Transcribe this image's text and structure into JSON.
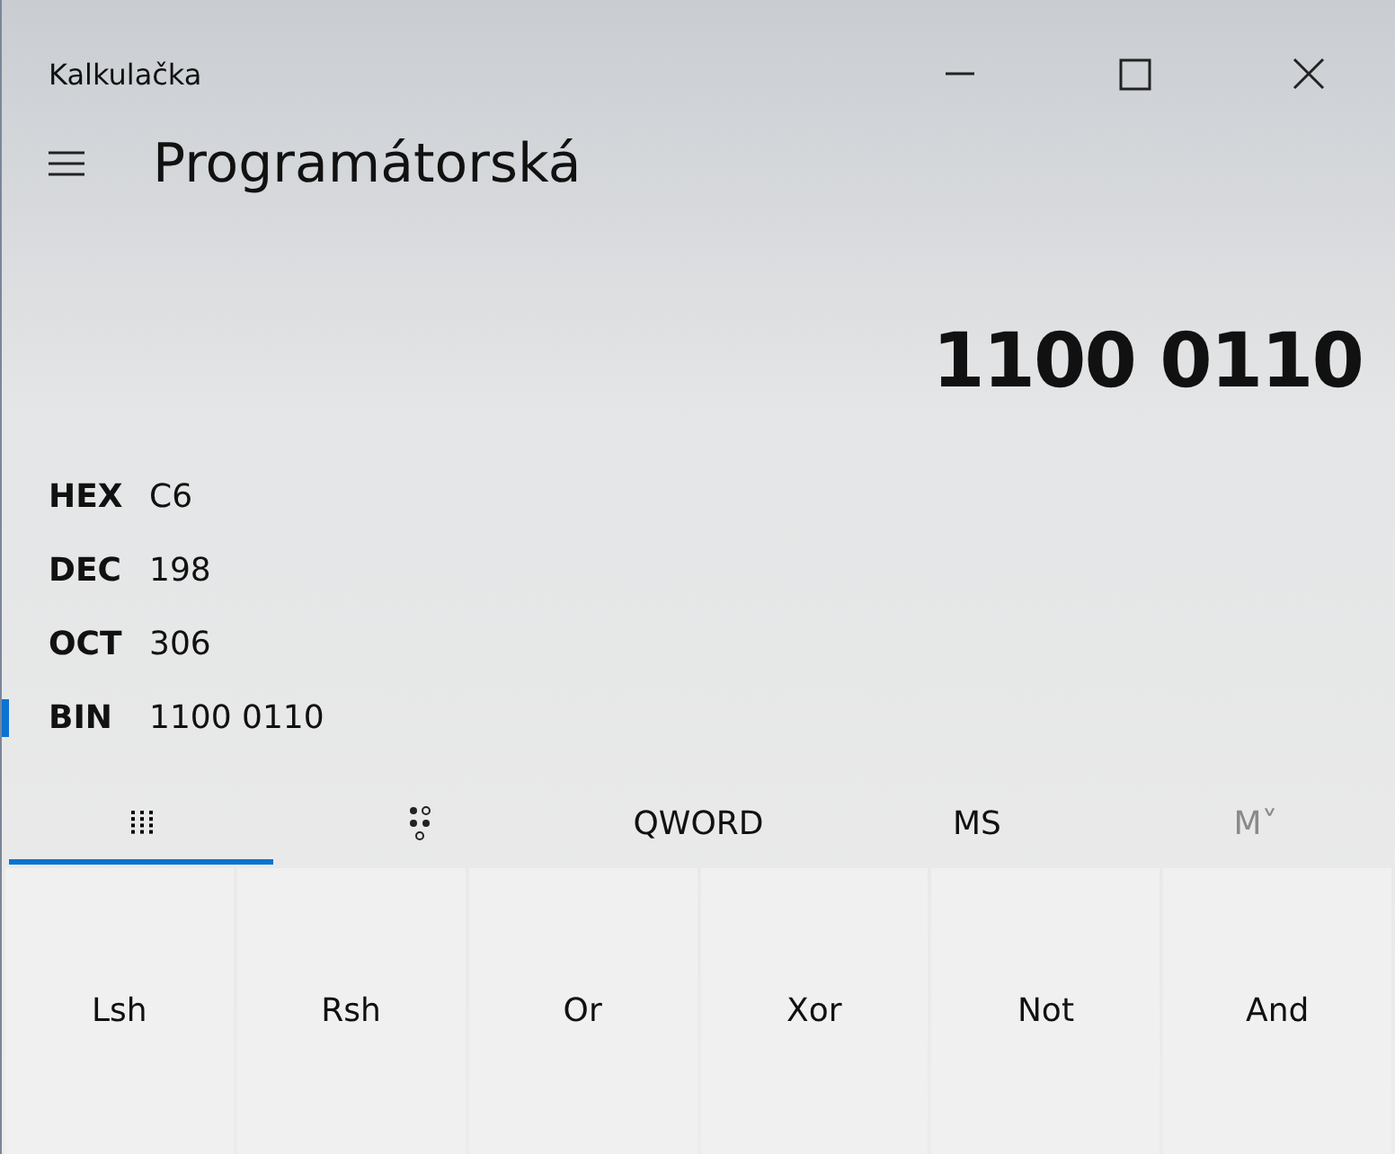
{
  "window": {
    "title": "Kalkulačka"
  },
  "header": {
    "title": "Programátorská"
  },
  "display": {
    "value": "1100 0110"
  },
  "radix": [
    {
      "label": "HEX",
      "value": "C6",
      "selected": false
    },
    {
      "label": "DEC",
      "value": "198",
      "selected": false
    },
    {
      "label": "OCT",
      "value": "306",
      "selected": false
    },
    {
      "label": "BIN",
      "value": "1100 0110",
      "selected": true
    }
  ],
  "toolbar": [
    {
      "kind": "keypad",
      "selected": true,
      "disabled": false
    },
    {
      "kind": "bits",
      "selected": false,
      "disabled": false
    },
    {
      "kind": "text",
      "label": "QWORD",
      "selected": false,
      "disabled": false
    },
    {
      "kind": "text",
      "label": "MS",
      "selected": false,
      "disabled": false
    },
    {
      "kind": "text",
      "label": "M˅",
      "selected": false,
      "disabled": true
    }
  ],
  "keys": [
    "Lsh",
    "Rsh",
    "Or",
    "Xor",
    "Not",
    "And"
  ]
}
